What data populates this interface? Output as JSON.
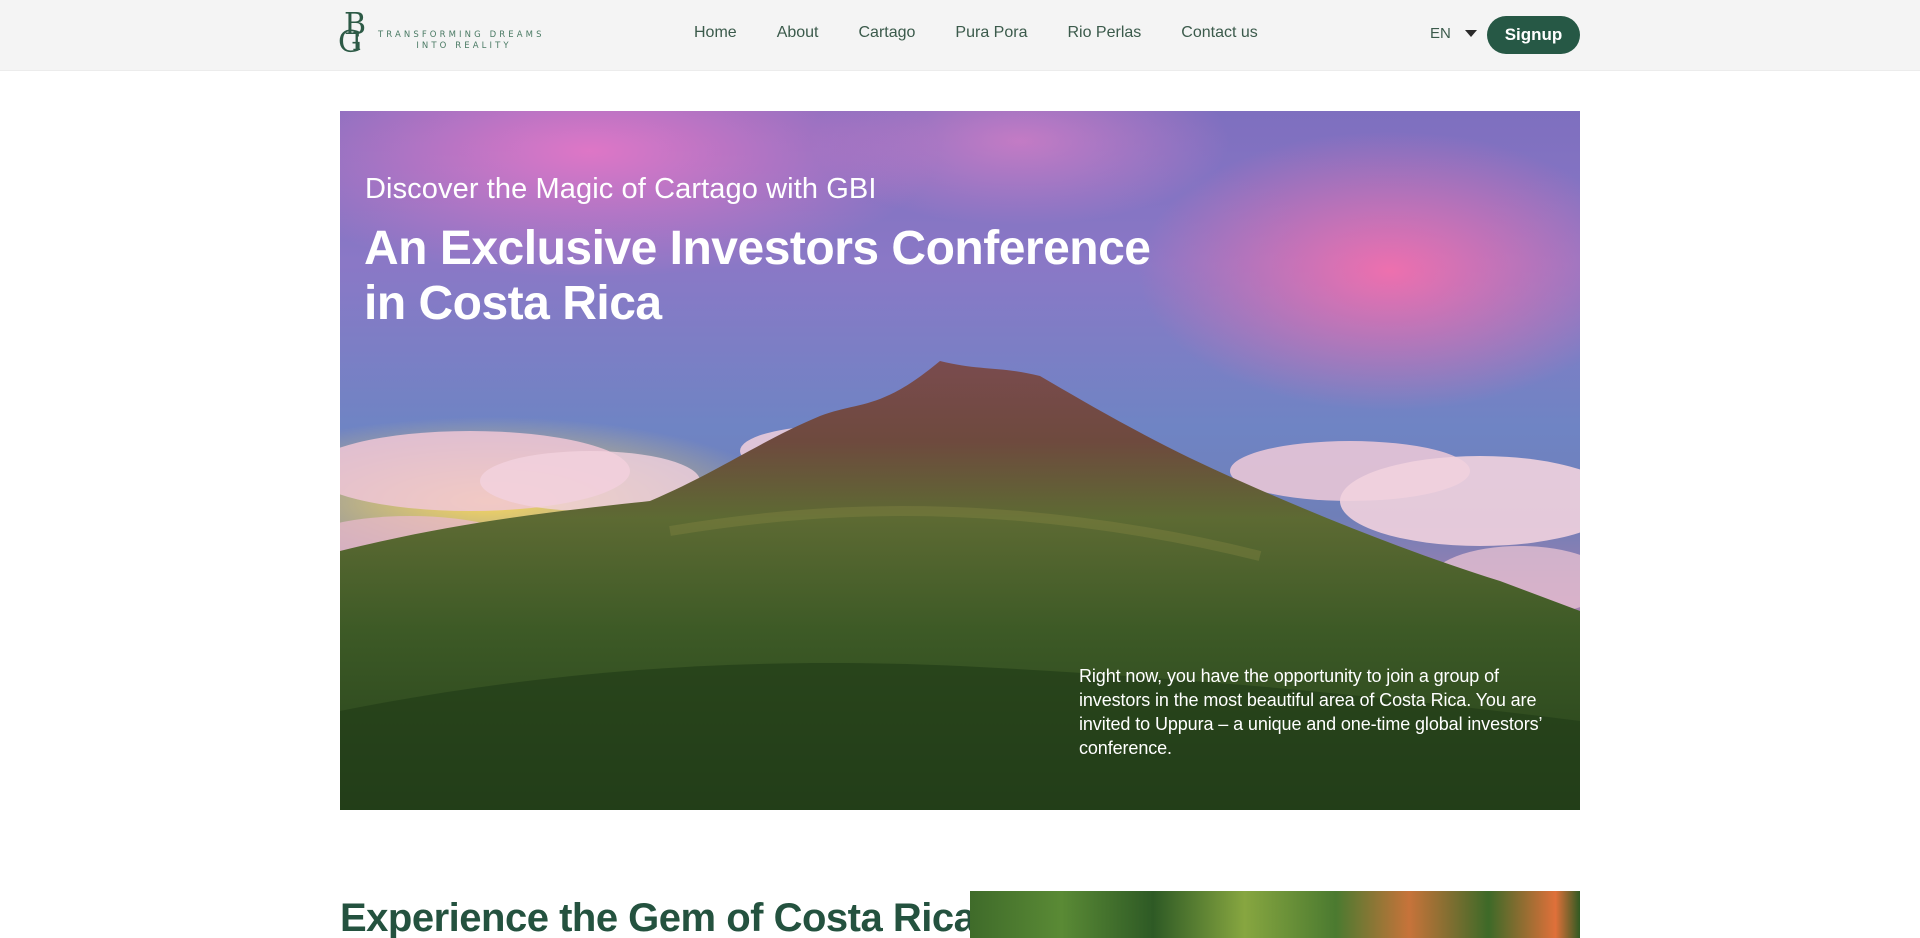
{
  "header": {
    "logo_tagline_line1": "TRANSFORMING DREAMS",
    "logo_tagline_line2": "INTO REALITY",
    "nav": [
      "Home",
      "About",
      "Cartago",
      "Pura Pora",
      "Rio Perlas",
      "Contact us"
    ],
    "language": "EN",
    "signup_label": "Signup"
  },
  "hero": {
    "subtitle": "Discover the Magic of Cartago with GBI",
    "title": "An Exclusive Investors Conference in Costa Rica",
    "description": "Right now, you have the opportunity to join a group of investors in the most beautiful area of Costa Rica. You are invited to Uppura – a unique and one-time global investors’ conference."
  },
  "section": {
    "title": "Experience the Gem of Costa Rica"
  },
  "colors": {
    "brand_green": "#265845",
    "heading_green": "#24523f",
    "topbar_bg": "#f4f4f4"
  }
}
